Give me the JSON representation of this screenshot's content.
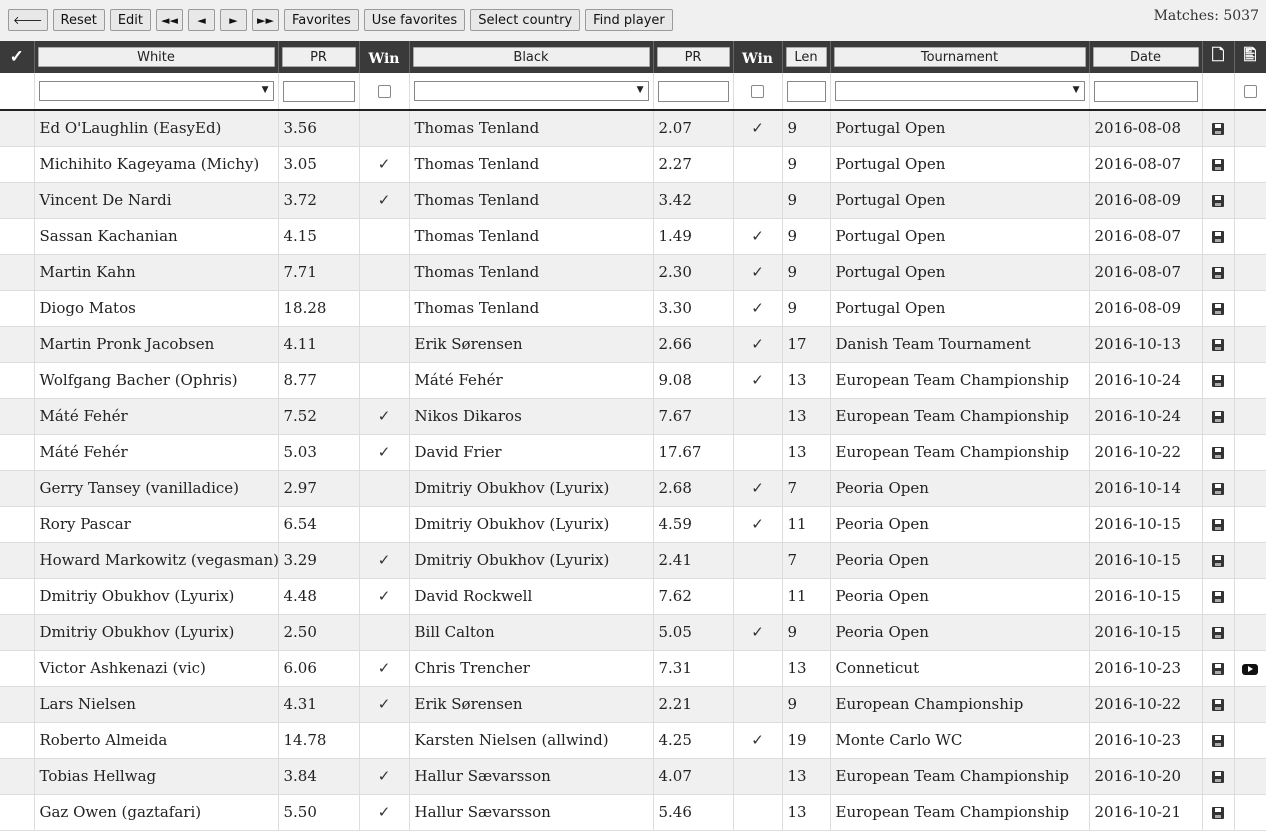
{
  "toolbar": {
    "back_label": "🡐",
    "reset_label": "Reset",
    "edit_label": "Edit",
    "first_label": "◄◄",
    "prev_label": "◄",
    "next_label": "►",
    "last_label": "►►",
    "favorites_label": "Favorites",
    "use_favorites_label": "Use favorites",
    "select_country_label": "Select country",
    "find_player_label": "Find player",
    "matches_label": "Matches: 5037"
  },
  "headers": {
    "select_all": "✓",
    "white": "White",
    "pr_white": "PR",
    "win_white": "Win",
    "black": "Black",
    "pr_black": "PR",
    "win_black": "Win",
    "len": "Len",
    "tournament": "Tournament",
    "date": "Date"
  },
  "rows": [
    {
      "white": "Ed O'Laughlin (EasyEd)",
      "pr_w": "3.56",
      "win_w": "",
      "black": "Thomas Tenland",
      "pr_b": "2.07",
      "win_b": "✓",
      "len": "9",
      "tournament": "Portugal Open",
      "date": "2016-08-08",
      "video": false
    },
    {
      "white": "Michihito Kageyama (Michy)",
      "pr_w": "3.05",
      "win_w": "✓",
      "black": "Thomas Tenland",
      "pr_b": "2.27",
      "win_b": "",
      "len": "9",
      "tournament": "Portugal Open",
      "date": "2016-08-07",
      "video": false
    },
    {
      "white": "Vincent De Nardi",
      "pr_w": "3.72",
      "win_w": "✓",
      "black": "Thomas Tenland",
      "pr_b": "3.42",
      "win_b": "",
      "len": "9",
      "tournament": "Portugal Open",
      "date": "2016-08-09",
      "video": false
    },
    {
      "white": "Sassan Kachanian",
      "pr_w": "4.15",
      "win_w": "",
      "black": "Thomas Tenland",
      "pr_b": "1.49",
      "win_b": "✓",
      "len": "9",
      "tournament": "Portugal Open",
      "date": "2016-08-07",
      "video": false
    },
    {
      "white": "Martin Kahn",
      "pr_w": "7.71",
      "win_w": "",
      "black": "Thomas Tenland",
      "pr_b": "2.30",
      "win_b": "✓",
      "len": "9",
      "tournament": "Portugal Open",
      "date": "2016-08-07",
      "video": false
    },
    {
      "white": "Diogo Matos",
      "pr_w": "18.28",
      "win_w": "",
      "black": "Thomas Tenland",
      "pr_b": "3.30",
      "win_b": "✓",
      "len": "9",
      "tournament": "Portugal Open",
      "date": "2016-08-09",
      "video": false
    },
    {
      "white": "Martin Pronk Jacobsen",
      "pr_w": "4.11",
      "win_w": "",
      "black": "Erik Sørensen",
      "pr_b": "2.66",
      "win_b": "✓",
      "len": "17",
      "tournament": "Danish Team Tournament",
      "date": "2016-10-13",
      "video": false
    },
    {
      "white": "Wolfgang Bacher (Ophris)",
      "pr_w": "8.77",
      "win_w": "",
      "black": "Máté Fehér",
      "pr_b": "9.08",
      "win_b": "✓",
      "len": "13",
      "tournament": "European Team Championship",
      "date": "2016-10-24",
      "video": false
    },
    {
      "white": "Máté Fehér",
      "pr_w": "7.52",
      "win_w": "✓",
      "black": "Nikos Dikaros",
      "pr_b": "7.67",
      "win_b": "",
      "len": "13",
      "tournament": "European Team Championship",
      "date": "2016-10-24",
      "video": false
    },
    {
      "white": "Máté Fehér",
      "pr_w": "5.03",
      "win_w": "✓",
      "black": "David Frier",
      "pr_b": "17.67",
      "win_b": "",
      "len": "13",
      "tournament": "European Team Championship",
      "date": "2016-10-22",
      "video": false
    },
    {
      "white": "Gerry Tansey (vanilladice)",
      "pr_w": "2.97",
      "win_w": "",
      "black": "Dmitriy Obukhov (Lyurix)",
      "pr_b": "2.68",
      "win_b": "✓",
      "len": "7",
      "tournament": "Peoria Open",
      "date": "2016-10-14",
      "video": false
    },
    {
      "white": "Rory Pascar",
      "pr_w": "6.54",
      "win_w": "",
      "black": "Dmitriy Obukhov (Lyurix)",
      "pr_b": "4.59",
      "win_b": "✓",
      "len": "11",
      "tournament": "Peoria Open",
      "date": "2016-10-15",
      "video": false
    },
    {
      "white": "Howard Markowitz (vegasman)",
      "pr_w": "3.29",
      "win_w": "✓",
      "black": "Dmitriy Obukhov (Lyurix)",
      "pr_b": "2.41",
      "win_b": "",
      "len": "7",
      "tournament": "Peoria Open",
      "date": "2016-10-15",
      "video": false
    },
    {
      "white": "Dmitriy Obukhov (Lyurix)",
      "pr_w": "4.48",
      "win_w": "✓",
      "black": "David Rockwell",
      "pr_b": "7.62",
      "win_b": "",
      "len": "11",
      "tournament": "Peoria Open",
      "date": "2016-10-15",
      "video": false
    },
    {
      "white": "Dmitriy Obukhov (Lyurix)",
      "pr_w": "2.50",
      "win_w": "",
      "black": "Bill Calton",
      "pr_b": "5.05",
      "win_b": "✓",
      "len": "9",
      "tournament": "Peoria Open",
      "date": "2016-10-15",
      "video": false
    },
    {
      "white": "Victor Ashkenazi (vic)",
      "pr_w": "6.06",
      "win_w": "✓",
      "black": "Chris Trencher",
      "pr_b": "7.31",
      "win_b": "",
      "len": "13",
      "tournament": "Conneticut",
      "date": "2016-10-23",
      "video": true
    },
    {
      "white": "Lars Nielsen",
      "pr_w": "4.31",
      "win_w": "✓",
      "black": "Erik Sørensen",
      "pr_b": "2.21",
      "win_b": "",
      "len": "9",
      "tournament": "European Championship",
      "date": "2016-10-22",
      "video": false
    },
    {
      "white": "Roberto Almeida",
      "pr_w": "14.78",
      "win_w": "",
      "black": "Karsten Nielsen (allwind)",
      "pr_b": "4.25",
      "win_b": "✓",
      "len": "19",
      "tournament": "Monte Carlo WC",
      "date": "2016-10-23",
      "video": false
    },
    {
      "white": "Tobias Hellwag",
      "pr_w": "3.84",
      "win_w": "✓",
      "black": "Hallur Sævarsson",
      "pr_b": "4.07",
      "win_b": "",
      "len": "13",
      "tournament": "European Team Championship",
      "date": "2016-10-20",
      "video": false
    },
    {
      "white": "Gaz Owen (gaztafari)",
      "pr_w": "5.50",
      "win_w": "✓",
      "black": "Hallur Sævarsson",
      "pr_b": "5.46",
      "win_b": "",
      "len": "13",
      "tournament": "European Team Championship",
      "date": "2016-10-21",
      "video": false
    }
  ]
}
